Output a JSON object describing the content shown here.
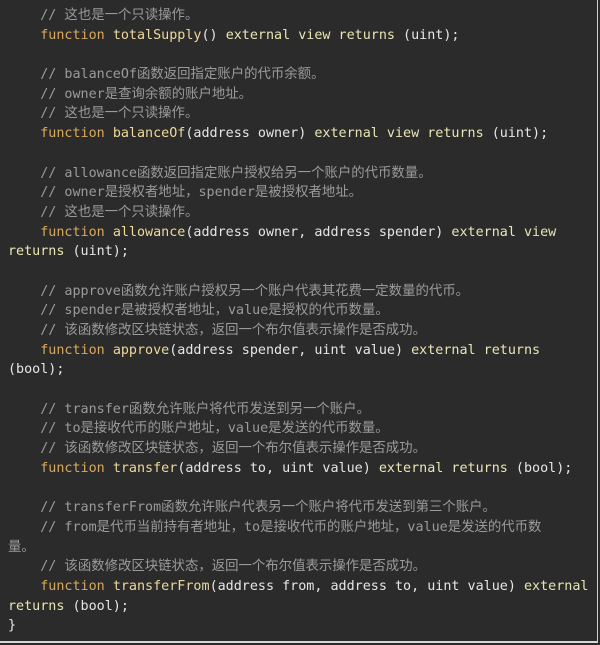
{
  "colors": {
    "background": "#2b2b2b",
    "comment": "#9b9b9b",
    "function_keyword": "#d9a95e",
    "function_name": "#eed89a",
    "keyword": "#e8e6b4",
    "text": "#e6e6e6"
  },
  "lines": [
    [
      {
        "t": "cmt",
        "v": "    // 这也是一个只读操作。"
      }
    ],
    [
      {
        "t": "kw-fn",
        "v": "    function "
      },
      {
        "t": "fname",
        "v": "totalSupply"
      },
      {
        "t": "plain",
        "v": "() "
      },
      {
        "t": "kw",
        "v": "external view returns"
      },
      {
        "t": "plain",
        "v": " (uint);"
      }
    ],
    [],
    [
      {
        "t": "cmt",
        "v": "    // balanceOf函数返回指定账户的代币余额。"
      }
    ],
    [
      {
        "t": "cmt",
        "v": "    // owner是查询余额的账户地址。"
      }
    ],
    [
      {
        "t": "cmt",
        "v": "    // 这也是一个只读操作。"
      }
    ],
    [
      {
        "t": "kw-fn",
        "v": "    function "
      },
      {
        "t": "fname",
        "v": "balanceOf"
      },
      {
        "t": "plain",
        "v": "(address owner) "
      },
      {
        "t": "kw",
        "v": "external view returns"
      },
      {
        "t": "plain",
        "v": " (uint);"
      }
    ],
    [],
    [
      {
        "t": "cmt",
        "v": "    // allowance函数返回指定账户授权给另一个账户的代币数量。"
      }
    ],
    [
      {
        "t": "cmt",
        "v": "    // owner是授权者地址，spender是被授权者地址。"
      }
    ],
    [
      {
        "t": "cmt",
        "v": "    // 这也是一个只读操作。"
      }
    ],
    [
      {
        "t": "kw-fn",
        "v": "    function "
      },
      {
        "t": "fname",
        "v": "allowance"
      },
      {
        "t": "plain",
        "v": "(address owner, address spender) "
      },
      {
        "t": "kw",
        "v": "external view"
      }
    ],
    [
      {
        "t": "kw",
        "v": "returns"
      },
      {
        "t": "plain",
        "v": " (uint);"
      }
    ],
    [],
    [
      {
        "t": "cmt",
        "v": "    // approve函数允许账户授权另一个账户代表其花费一定数量的代币。"
      }
    ],
    [
      {
        "t": "cmt",
        "v": "    // spender是被授权者地址，value是授权的代币数量。"
      }
    ],
    [
      {
        "t": "cmt",
        "v": "    // 该函数修改区块链状态，返回一个布尔值表示操作是否成功。"
      }
    ],
    [
      {
        "t": "kw-fn",
        "v": "    function "
      },
      {
        "t": "fname",
        "v": "approve"
      },
      {
        "t": "plain",
        "v": "(address spender, uint value) "
      },
      {
        "t": "kw",
        "v": "external returns"
      }
    ],
    [
      {
        "t": "plain",
        "v": "(bool);"
      }
    ],
    [],
    [
      {
        "t": "cmt",
        "v": "    // transfer函数允许账户将代币发送到另一个账户。"
      }
    ],
    [
      {
        "t": "cmt",
        "v": "    // to是接收代币的账户地址，value是发送的代币数量。"
      }
    ],
    [
      {
        "t": "cmt",
        "v": "    // 该函数修改区块链状态，返回一个布尔值表示操作是否成功。"
      }
    ],
    [
      {
        "t": "kw-fn",
        "v": "    function "
      },
      {
        "t": "fname",
        "v": "transfer"
      },
      {
        "t": "plain",
        "v": "(address to, uint value) "
      },
      {
        "t": "kw",
        "v": "external returns"
      },
      {
        "t": "plain",
        "v": " (bool);"
      }
    ],
    [],
    [
      {
        "t": "cmt",
        "v": "    // transferFrom函数允许账户代表另一个账户将代币发送到第三个账户。"
      }
    ],
    [
      {
        "t": "cmt",
        "v": "    // from是代币当前持有者地址，to是接收代币的账户地址，value是发送的代币数"
      }
    ],
    [
      {
        "t": "cmt",
        "v": "量。"
      }
    ],
    [
      {
        "t": "cmt",
        "v": "    // 该函数修改区块链状态，返回一个布尔值表示操作是否成功。"
      }
    ],
    [
      {
        "t": "kw-fn",
        "v": "    function "
      },
      {
        "t": "fname",
        "v": "transferFrom"
      },
      {
        "t": "plain",
        "v": "(address from, address to, uint value) "
      },
      {
        "t": "kw",
        "v": "external"
      }
    ],
    [
      {
        "t": "kw",
        "v": "returns"
      },
      {
        "t": "plain",
        "v": " (bool);"
      }
    ],
    [
      {
        "t": "plain",
        "v": "}"
      }
    ]
  ]
}
